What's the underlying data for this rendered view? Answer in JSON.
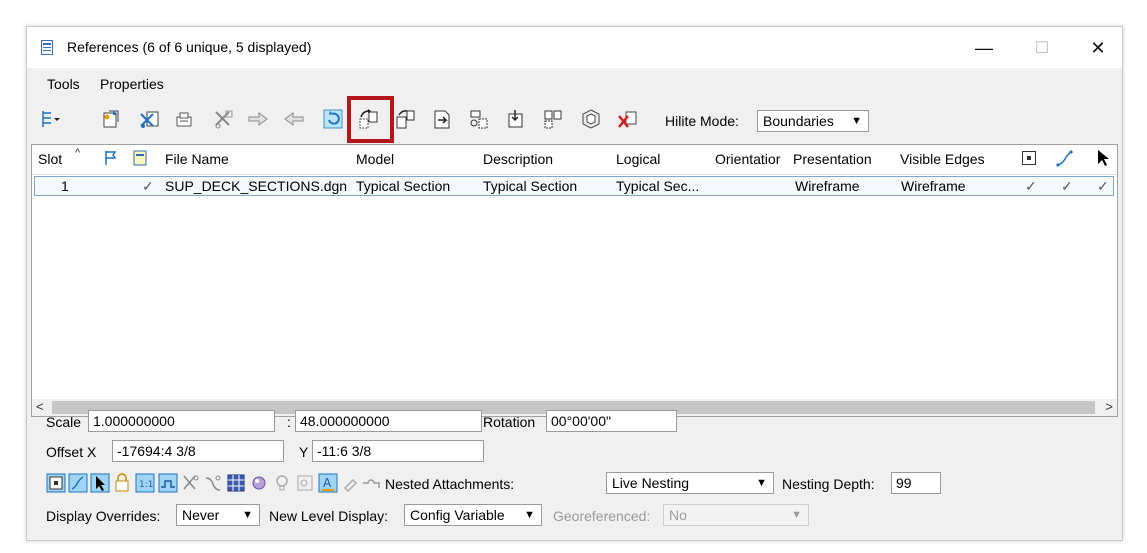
{
  "window": {
    "title": "References (6 of 6 unique, 5 displayed)",
    "minimize": "—",
    "maximize": "☐",
    "close": "✕"
  },
  "menu": {
    "tools": "Tools",
    "properties": "Properties"
  },
  "toolbar": {
    "hilite_label": "Hilite Mode:",
    "hilite_value": "Boundaries",
    "icons": [
      "list-view-icon",
      "attach-reference-icon",
      "detach-reference-icon",
      "reload-reference-icon",
      "clip-boundary-icon",
      "move-reference-icon",
      "copy-reference-icon",
      "exchange-icon",
      "rotate-reference-icon",
      "scale-reference-icon",
      "mirror-horizontal-icon",
      "mirror-vertical-icon",
      "clip-mask-icon",
      "clip-delete-icon",
      "clip-front-icon",
      "clip-back-icon",
      "delete-clip-icon"
    ],
    "highlighted_tool": "rotate-reference-icon"
  },
  "table": {
    "headers": {
      "slot": "Slot",
      "file_name": "File Name",
      "model": "Model",
      "description": "Description",
      "logical": "Logical",
      "orientation": "Orientatior",
      "presentation": "Presentation",
      "visible_edges": "Visible Edges"
    },
    "rows": [
      {
        "slot": "1",
        "check": "✓",
        "file_name": "SUP_DECK_SECTIONS.dgn",
        "model": "Typical Section",
        "description": "Typical Section",
        "logical": "Typical Sec...",
        "orientation": "",
        "presentation": "Wireframe",
        "visible_edges": "Wireframe",
        "display": "✓",
        "snap": "✓",
        "locate": "✓"
      }
    ]
  },
  "properties": {
    "scale_label": "Scale",
    "scale_value": "1.000000000",
    "scale_sep": ":",
    "scale_value2": "48.000000000",
    "rotation_label": "Rotation",
    "rotation_value": "00°00'00\"",
    "offset_x_label": "Offset X",
    "offset_x_value": "-17694:4 3/8",
    "offset_y_label": "Y",
    "offset_y_value": "-11:6 3/8",
    "nested_label": "Nested Attachments:",
    "nested_value": "Live Nesting",
    "depth_label": "Nesting Depth:",
    "depth_value": "99",
    "display_overrides_label": "Display Overrides:",
    "display_overrides_value": "Never",
    "new_level_label": "New Level Display:",
    "new_level_value": "Config Variable",
    "georef_label": "Georeferenced:",
    "georef_value": "No"
  },
  "colors": {
    "highlight_border": "#b3171c",
    "selection_border": "#7aa7d6",
    "icon_blue": "#1e73be",
    "icon_red": "#d31f1f"
  }
}
